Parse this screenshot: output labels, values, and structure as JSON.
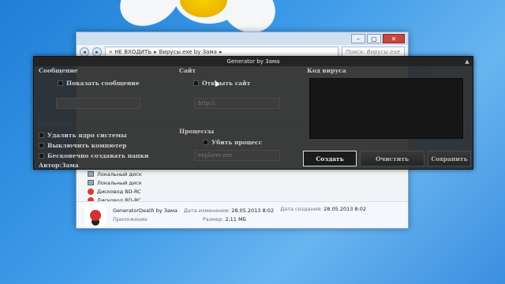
{
  "explorer": {
    "window_controls": {
      "minimize": "–",
      "maximize": "▢",
      "close": "✕"
    },
    "nav": {
      "back": "◂",
      "forward": "▸"
    },
    "address": {
      "separator": "«",
      "segment_1": "НЕ ВХОДИТЬ",
      "segment_2": "Вирусы.exe by Зама",
      "arrow": "▸"
    },
    "search_placeholder": "Поиск: Вирусы.exe by Зама",
    "tree": [
      {
        "label": "Локальный диск",
        "icon": "drive-icon"
      },
      {
        "label": "Локальный диск",
        "icon": "drive-icon"
      },
      {
        "label": "Дисковод BD-RC",
        "icon": "disc-icon"
      },
      {
        "label": "Дисковод BD-RC",
        "icon": "disc-icon"
      }
    ],
    "details": {
      "name": "GeneratorDeath by Зама",
      "type": "Приложение",
      "modified_label": "Дата изменения:",
      "modified_value": "28.05.2013 8:02",
      "size_label": "Размер:",
      "size_value": "2,11 МБ",
      "created_label": "Дата создания:",
      "created_value": "28.05.2013 8:02"
    }
  },
  "dialog": {
    "title": "Generator by Зама",
    "title_icon": "▲",
    "message": {
      "header": "Сообщение",
      "show_message": "Показать сообщение",
      "text_field": ""
    },
    "site": {
      "header": "Сайт",
      "open_site": "Открыть сайт",
      "url_placeholder": "http:\\\\"
    },
    "code": {
      "header": "Код вируса"
    },
    "options": {
      "delete_core": "Удалить ядро системы",
      "shutdown": "Выключить компютер",
      "infinite_folders": "Бесконечно создавать папки"
    },
    "processes": {
      "header": "Процессы",
      "kill_process": "Убить процесс",
      "process_placeholder": "explorer.exe"
    },
    "buttons": {
      "create": "Создать",
      "clear": "Очистить",
      "save": "Сохранить"
    },
    "author": "Автор:Зама"
  }
}
